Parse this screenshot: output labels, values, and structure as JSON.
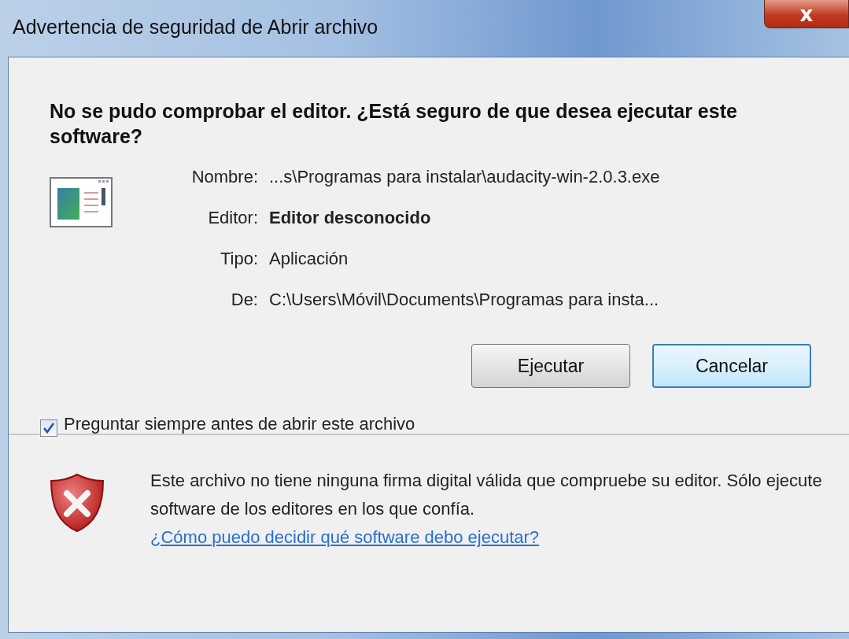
{
  "window": {
    "title": "Advertencia de seguridad de Abrir archivo",
    "close": "x"
  },
  "heading": "No se pudo comprobar el editor. ¿Está seguro de que desea ejecutar este software?",
  "details": [
    {
      "label": "Nombre:",
      "value": "...s\\Programas para instalar\\audacity-win-2.0.3.exe",
      "bold": false
    },
    {
      "label": "Editor:",
      "value": "Editor desconocido",
      "bold": true
    },
    {
      "label": "Tipo:",
      "value": "Aplicación",
      "bold": false
    },
    {
      "label": "De:",
      "value": "C:\\Users\\Móvil\\Documents\\Programas para insta...",
      "bold": false
    }
  ],
  "buttons": [
    {
      "label": "Ejecutar",
      "selected": false
    },
    {
      "label": "Cancelar",
      "selected": true
    }
  ],
  "checkbox": {
    "label": "Preguntar siempre antes de abrir este archivo",
    "checked": true
  },
  "footer": {
    "text": "Este archivo no tiene ninguna firma digital válida que compruebe su editor. Sólo ejecute software de los editores en los que confía.",
    "link": "¿Cómo puedo decidir qué software debo ejecutar?"
  }
}
